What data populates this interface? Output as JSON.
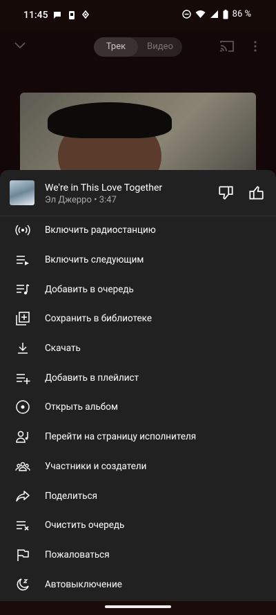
{
  "status": {
    "time": "11:45",
    "battery": "86 %"
  },
  "player": {
    "tab_track": "Трек",
    "tab_video": "Видео"
  },
  "song": {
    "title": "We're in This Love Together",
    "artist": "Эл Джерро",
    "duration": "3:47"
  },
  "menu": {
    "items": [
      {
        "label": "Включить радиостанцию",
        "icon": "radio-icon"
      },
      {
        "label": "Включить следующим",
        "icon": "play-next-icon"
      },
      {
        "label": "Добавить в очередь",
        "icon": "queue-music-icon"
      },
      {
        "label": "Сохранить в библиотеке",
        "icon": "library-add-icon"
      },
      {
        "label": "Скачать",
        "icon": "download-icon"
      },
      {
        "label": "Добавить в плейлист",
        "icon": "playlist-add-icon"
      },
      {
        "label": "Открыть альбом",
        "icon": "album-icon"
      },
      {
        "label": "Перейти на страницу исполнителя",
        "icon": "artist-icon"
      },
      {
        "label": "Участники и создатели",
        "icon": "credits-icon"
      },
      {
        "label": "Поделиться",
        "icon": "share-icon"
      },
      {
        "label": "Очистить очередь",
        "icon": "clear-queue-icon"
      },
      {
        "label": "Пожаловаться",
        "icon": "flag-icon"
      },
      {
        "label": "Автовыключение",
        "icon": "sleep-timer-icon"
      }
    ]
  }
}
